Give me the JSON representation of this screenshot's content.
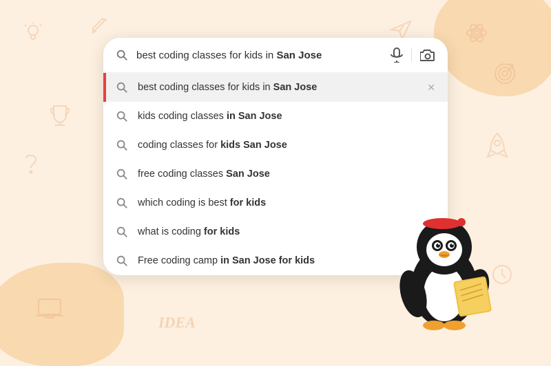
{
  "background": {
    "blob_color": "#f9d9b0",
    "base_color": "#fdf0e0"
  },
  "searchbar": {
    "query": "best coding classes for kids in ",
    "query_bold": "San Jose",
    "mic_label": "microphone",
    "camera_label": "camera"
  },
  "suggestions": [
    {
      "id": 0,
      "text_normal": "best coding classes for kids in ",
      "text_bold": "San Jose",
      "has_close": true,
      "active": true
    },
    {
      "id": 1,
      "text_normal": "kids coding classes ",
      "text_bold": "in San Jose",
      "has_close": false,
      "active": false
    },
    {
      "id": 2,
      "text_normal": "coding classes for ",
      "text_bold": "kids San Jose",
      "has_close": false,
      "active": false
    },
    {
      "id": 3,
      "text_normal": "free coding classes ",
      "text_bold": "San Jose",
      "has_close": false,
      "active": false
    },
    {
      "id": 4,
      "text_normal": "which coding is best ",
      "text_bold": "for kids",
      "has_close": false,
      "active": false
    },
    {
      "id": 5,
      "text_normal": "what is coding ",
      "text_bold": "for kids",
      "has_close": false,
      "active": false
    },
    {
      "id": 6,
      "text_normal": "Free coding camp ",
      "text_bold": "in San Jose for kids",
      "has_close": false,
      "active": false
    }
  ]
}
